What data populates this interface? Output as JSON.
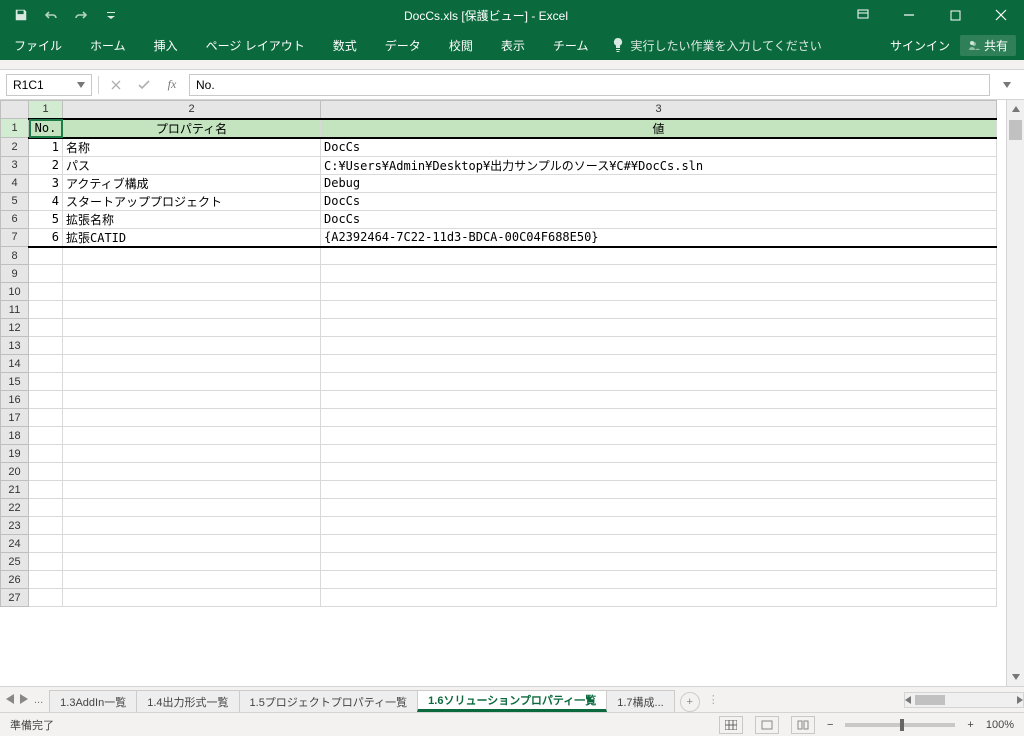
{
  "window": {
    "title": "DocCs.xls [保護ビュー] - Excel",
    "signin": "サインイン",
    "share": "共有"
  },
  "ribbon": {
    "tabs": [
      "ファイル",
      "ホーム",
      "挿入",
      "ページ レイアウト",
      "数式",
      "データ",
      "校閲",
      "表示",
      "チーム"
    ],
    "tellme": "実行したい作業を入力してください"
  },
  "formula_bar": {
    "name_box": "R1C1",
    "formula": "No."
  },
  "columns": [
    "1",
    "2",
    "3"
  ],
  "header_row": {
    "no": "No.",
    "prop": "プロパティ名",
    "val": "値"
  },
  "rows": [
    {
      "no": "1",
      "prop": "名称",
      "val": "DocCs"
    },
    {
      "no": "2",
      "prop": "パス",
      "val": "C:¥Users¥Admin¥Desktop¥出力サンプルのソース¥C#¥DocCs.sln"
    },
    {
      "no": "3",
      "prop": "アクティブ構成",
      "val": "Debug"
    },
    {
      "no": "4",
      "prop": "スタートアッププロジェクト",
      "val": "DocCs"
    },
    {
      "no": "5",
      "prop": "拡張名称",
      "val": "DocCs"
    },
    {
      "no": "6",
      "prop": "拡張CATID",
      "val": "{A2392464-7C22-11d3-BDCA-00C04F688E50}"
    }
  ],
  "row_headers": [
    "1",
    "2",
    "3",
    "4",
    "5",
    "6",
    "7",
    "8",
    "9",
    "10",
    "11",
    "12",
    "13",
    "14",
    "15",
    "16",
    "17",
    "18",
    "19",
    "20",
    "21",
    "22",
    "23",
    "24",
    "25",
    "26",
    "27"
  ],
  "sheet_tabs": {
    "items": [
      "1.3AddIn一覧",
      "1.4出力形式一覧",
      "1.5プロジェクトプロパティ一覧",
      "1.6ソリューションプロパティ一覧",
      "1.7構成..."
    ],
    "active_index": 3,
    "ellipsis": "..."
  },
  "status": {
    "ready": "準備完了",
    "zoom": "100%"
  }
}
